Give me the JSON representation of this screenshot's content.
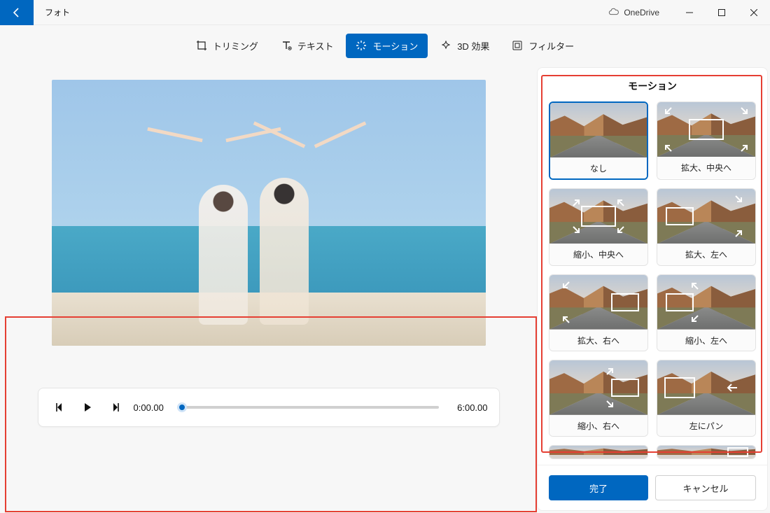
{
  "titlebar": {
    "app_title": "フォト",
    "onedrive": "OneDrive"
  },
  "toolbar": {
    "trimming": "トリミング",
    "text": "テキスト",
    "motion": "モーション",
    "effect3d": "3D 効果",
    "filter": "フィルター"
  },
  "playback": {
    "start": "0:00.00",
    "end": "6:00.00"
  },
  "panel": {
    "title": "モーション",
    "done": "完了",
    "cancel": "キャンセル",
    "options": [
      {
        "label": "なし",
        "selected": true
      },
      {
        "label": "拡大、中央へ"
      },
      {
        "label": "縮小、中央へ"
      },
      {
        "label": "拡大、左へ"
      },
      {
        "label": "拡大、右へ"
      },
      {
        "label": "縮小、左へ"
      },
      {
        "label": "縮小、右へ"
      },
      {
        "label": "左にパン"
      }
    ]
  }
}
